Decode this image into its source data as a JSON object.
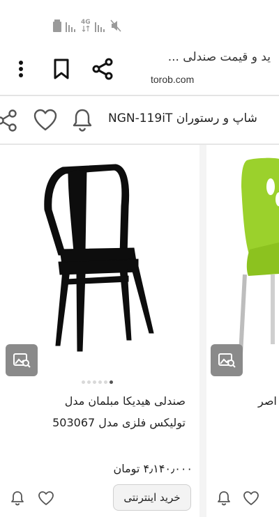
{
  "status_bar": {
    "network_label": "4G",
    "icons": [
      "battery-icon",
      "signal-icon",
      "signal-icon",
      "mute-icon"
    ]
  },
  "browser": {
    "page_title": "ید و قیمت صندلی ...",
    "url": "torob.com",
    "icons": [
      "more-vert-icon",
      "bookmark-icon",
      "share-icon"
    ]
  },
  "product_header": {
    "name": "شاپ و رستوران NGN-119iT",
    "icons": [
      "share-icon",
      "heart-icon",
      "bell-icon"
    ]
  },
  "cards": [
    {
      "title_line1": "صندلی هیدیکا مبلمان مدل",
      "title_line2": "تولیکس فلزی مدل 503067",
      "price": "۴٫۱۴۰٫۰۰۰ تومان",
      "buy_label": "خرید اینترنتی",
      "image_dots": 6,
      "active_dot": 5,
      "image_color": "#0d0d0d"
    },
    {
      "title_partial": "اصر",
      "image_color": "#9bd12c"
    }
  ]
}
